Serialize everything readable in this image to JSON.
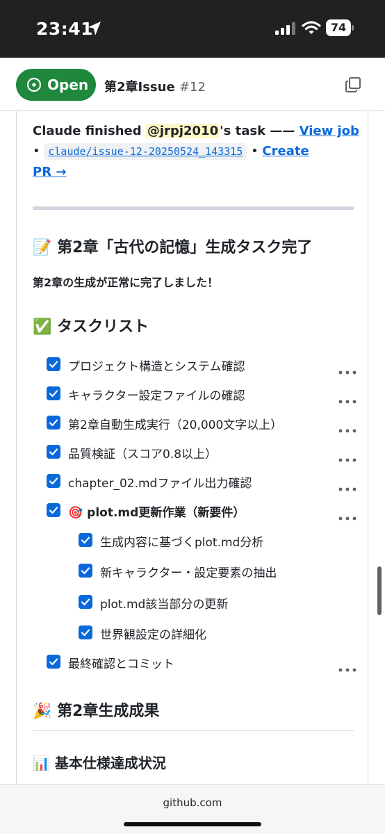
{
  "status_bar": {
    "time": "23:41",
    "battery": "74"
  },
  "issue": {
    "state_label": "Open",
    "title": "第2章Issue",
    "number": "#12"
  },
  "comment": {
    "author": "Claude",
    "finished_text": " finished ",
    "mention": "@jrpj2010",
    "task_suffix": "'s task —— ",
    "view_job": "View job",
    "bullet": "•",
    "branch": "claude/issue-12-20250524_143315",
    "create_pr_line1": "Create",
    "create_pr_line2": "PR →",
    "heading_complete": "第2章「古代の記憶」生成タスク完了",
    "heading_complete_emoji": "📝",
    "success_message": "第2章の生成が正常に完了しました！",
    "heading_tasks": "タスクリスト",
    "heading_tasks_emoji": "✅",
    "tasks": [
      {
        "label": "プロジェクト構造とシステム確認",
        "checked": true
      },
      {
        "label": "キャラクター設定ファイルの確認",
        "checked": true
      },
      {
        "label": "第2章自動生成実行（20,000文字以上）",
        "checked": true
      },
      {
        "label": "品質検証（スコア0.8以上）",
        "checked": true
      },
      {
        "label": "chapter_02.mdファイル出力確認",
        "checked": true
      },
      {
        "label": "plot.md更新作業（新要件）",
        "emoji": "🎯",
        "checked": true
      },
      {
        "label": "最終確認とコミット",
        "checked": true
      }
    ],
    "subtasks": [
      {
        "label": "生成内容に基づくplot.md分析",
        "checked": true
      },
      {
        "label": "新キャラクター・設定要素の抽出",
        "checked": true
      },
      {
        "label": "plot.md該当部分の更新",
        "checked": true
      },
      {
        "label": "世界観設定の詳細化",
        "checked": true
      }
    ],
    "heading_results": "第2章生成成果",
    "heading_results_emoji": "🎉",
    "heading_spec": "基本仕様達成状況",
    "heading_spec_emoji": "📊"
  },
  "browser": {
    "url": "github.com"
  },
  "colors": {
    "accent": "#0969da",
    "open_green": "#1f883d",
    "status_bar": "#1f2122"
  }
}
